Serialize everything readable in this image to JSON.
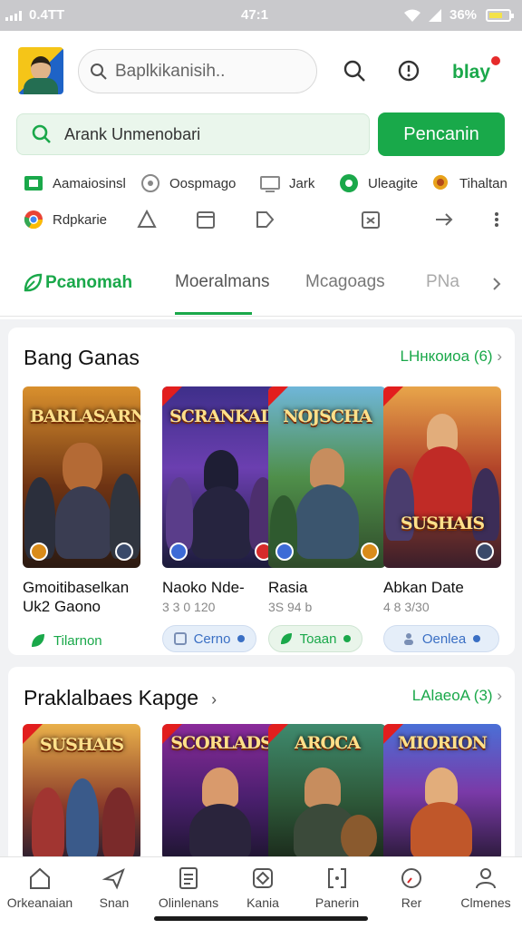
{
  "status_bar": {
    "carrier": "0.4TT",
    "time": "47:1",
    "battery": "36%"
  },
  "header": {
    "search_placeholder": "Baplkikanisih..",
    "play_label": "blay",
    "search_field_text": "Arank Unmenobari",
    "search_button": "Pencanin"
  },
  "categories": [
    {
      "label": "Aamaiosinsl",
      "icon": "app-square-icon",
      "color": "#1aa84a"
    },
    {
      "label": "Oospmago",
      "icon": "compass-icon",
      "color": "#888888"
    },
    {
      "label": "Jark",
      "icon": "monitor-icon",
      "color": "#888888"
    },
    {
      "label": "Uleagite",
      "icon": "green-circle-icon",
      "color": "#1aa84a"
    },
    {
      "label": "Tihaltan",
      "icon": "medal-icon",
      "color": "#e8a21a"
    },
    {
      "label": "Rdpkarie",
      "icon": "chrome-icon",
      "color": "#4285f4"
    }
  ],
  "tabs": [
    {
      "label": "Pcanomah",
      "active": true
    },
    {
      "label": "Moeralmans",
      "active": false
    },
    {
      "label": "Mcagoags",
      "active": false
    },
    {
      "label": "PNa",
      "active": false
    }
  ],
  "sections": [
    {
      "title": "Bang Ganas",
      "link": "LНнкоиоа (6)",
      "games": [
        {
          "cover_title": "BARLASARN",
          "name_line1": "Gmoitibaselkan",
          "name_line2": "Uk2 Gaono",
          "meta": "",
          "action": "Tilarnon",
          "style": "plain"
        },
        {
          "cover_title": "SCRANKAD",
          "name_line1": "Naoko Nde-",
          "name_line2": "",
          "meta": "3 3 0 120",
          "action": "Cerno",
          "style": "blue"
        },
        {
          "cover_title": "NOJSCHA",
          "name_line1": "Rasia",
          "name_line2": "",
          "meta": "3S 94 b",
          "action": "Toaan",
          "style": "green"
        },
        {
          "cover_title": "SUSHAIS",
          "name_line1": "Abkan Date",
          "name_line2": "",
          "meta": "4 8 3/30",
          "action": "Oenlea",
          "style": "blue"
        }
      ]
    },
    {
      "title": "Praklalbaes Kapge",
      "link": "LAlaeoA (3)",
      "games": [
        {
          "cover_title": "SUSHAIS"
        },
        {
          "cover_title": "SCORLADS"
        },
        {
          "cover_title": "AROCA"
        },
        {
          "cover_title": "MIORION"
        }
      ]
    }
  ],
  "bottom_nav": [
    {
      "label": "Orkeanaian",
      "icon": "home-icon"
    },
    {
      "label": "Snan",
      "icon": "plane-icon"
    },
    {
      "label": "Olinlenans",
      "icon": "document-icon"
    },
    {
      "label": "Kania",
      "icon": "diamond-icon"
    },
    {
      "label": "Panerin",
      "icon": "bracket-icon"
    },
    {
      "label": "Rer",
      "icon": "clock-icon"
    },
    {
      "label": "Clmenes",
      "icon": "person-icon"
    }
  ]
}
